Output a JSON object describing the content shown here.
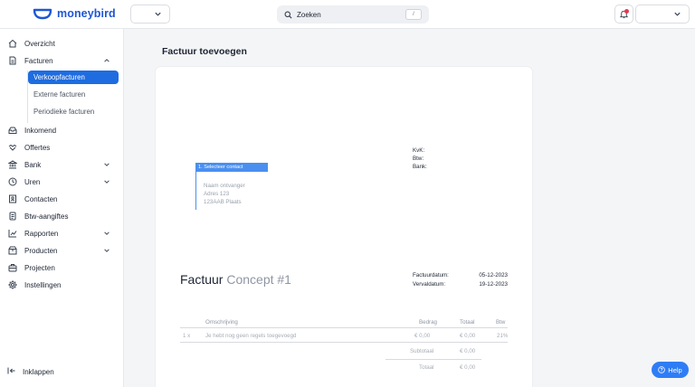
{
  "header": {
    "logo_text": "moneybird",
    "search_label": "Zoeken",
    "search_shortcut": "/",
    "notification_color": "#e5384f"
  },
  "sidebar": {
    "items": [
      {
        "label": "Overzicht",
        "icon": "home-icon"
      },
      {
        "label": "Facturen",
        "icon": "document-icon",
        "expanded": true
      },
      {
        "label": "Inkomend",
        "icon": "inbox-icon"
      },
      {
        "label": "Offertes",
        "icon": "handshake-icon"
      },
      {
        "label": "Bank",
        "icon": "bank-icon"
      },
      {
        "label": "Uren",
        "icon": "clock-icon"
      },
      {
        "label": "Contacten",
        "icon": "contact-icon"
      },
      {
        "label": "Btw-aangiftes",
        "icon": "tax-icon"
      },
      {
        "label": "Rapporten",
        "icon": "chart-icon"
      },
      {
        "label": "Producten",
        "icon": "box-icon"
      },
      {
        "label": "Projecten",
        "icon": "briefcase-icon"
      },
      {
        "label": "Instellingen",
        "icon": "gear-icon"
      }
    ],
    "sub_items": [
      {
        "label": "Verkoopfacturen",
        "active": true
      },
      {
        "label": "Externe facturen",
        "active": false
      },
      {
        "label": "Periodieke facturen",
        "active": false
      }
    ],
    "collapse_label": "Inklappen"
  },
  "main": {
    "title": "Factuur toevoegen",
    "invoice": {
      "select_contact": "1. Selecteer contact",
      "recipient_name": "Naam ontvanger",
      "recipient_address": "Adres 123",
      "recipient_city": "123AAB Plaats",
      "kvk_label": "KvK:",
      "btw_label": "Btw:",
      "bank_label": "Bank:",
      "title_word": "Factuur",
      "concept": "Concept #1",
      "invoice_date_label": "Factuurdatum:",
      "invoice_date": "05-12-2023",
      "due_date_label": "Vervaldatum:",
      "due_date": "19-12-2023",
      "columns": {
        "description": "Omschrijving",
        "amount": "Bedrag",
        "total": "Totaal",
        "vat": "Btw"
      },
      "line": {
        "qty": "1 x",
        "description": "Je hebt nog geen regels toegevoegd",
        "amount": "€ 0,00",
        "total": "€ 0,00",
        "vat": "21%"
      },
      "subtotal_label": "Subtotaal",
      "subtotal": "€ 0,00",
      "total_label": "Totaal",
      "total": "€ 0,00"
    }
  },
  "help_label": "Help",
  "colors": {
    "accent": "#1e6ce0",
    "brand": "#1e56d6",
    "help": "#2f7df6"
  }
}
